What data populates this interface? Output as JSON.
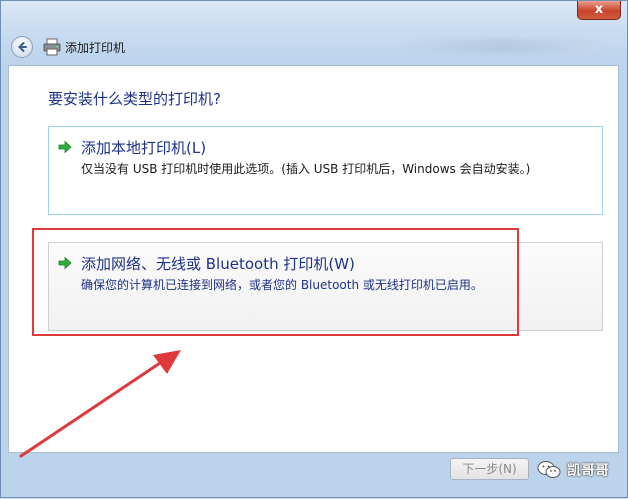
{
  "window": {
    "title": "添加打印机",
    "close_symbol": "x"
  },
  "page": {
    "question": "要安装什么类型的打印机?",
    "options": [
      {
        "title": "添加本地打印机(L)",
        "description": "仅当没有 USB 打印机时使用此选项。(插入 USB 打印机后，Windows 会自动安装。)",
        "icon": "green-arrow-icon"
      },
      {
        "title": "添加网络、无线或 Bluetooth 打印机(W)",
        "description": "确保您的计算机已连接到网络，或者您的 Bluetooth 或无线打印机已启用。",
        "icon": "green-arrow-icon"
      }
    ]
  },
  "footer": {
    "next_label": "下一步(N)"
  },
  "watermark": {
    "text": "凯哥哥",
    "icon": "wechat-icon"
  },
  "colors": {
    "annotation": "#e0393c",
    "heading_blue": "#1e3287",
    "option_border": "#9ad7ea"
  }
}
